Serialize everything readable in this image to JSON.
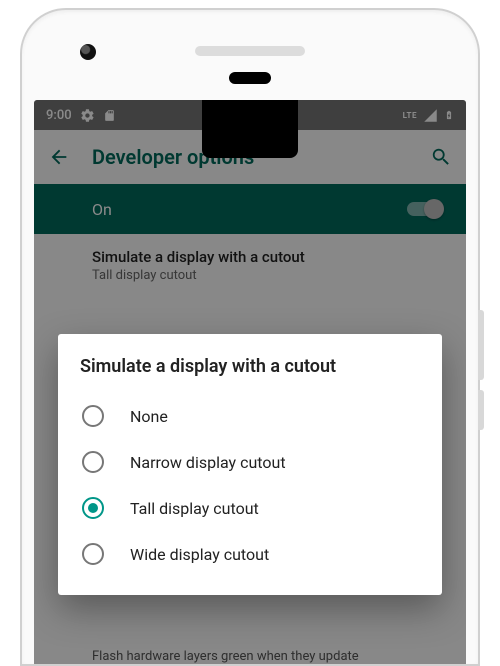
{
  "status": {
    "time": "9:00",
    "lte": "LTE"
  },
  "appbar": {
    "title": "Developer options"
  },
  "switch": {
    "label": "On",
    "state": true
  },
  "current_setting": {
    "title": "Simulate a display with a cutout",
    "value": "Tall display cutout"
  },
  "dialog": {
    "title": "Simulate a display with a cutout",
    "options": [
      {
        "label": "None",
        "selected": false
      },
      {
        "label": "Narrow display cutout",
        "selected": false
      },
      {
        "label": "Tall display cutout",
        "selected": true
      },
      {
        "label": "Wide display cutout",
        "selected": false
      }
    ]
  },
  "footer": {
    "text": "Flash hardware layers green when they update"
  },
  "colors": {
    "accent": "#009688",
    "accent_dark": "#00695c"
  }
}
